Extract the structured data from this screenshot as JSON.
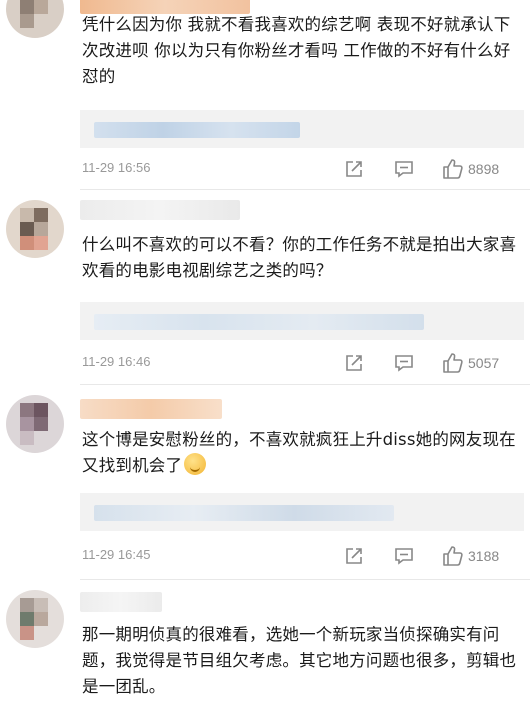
{
  "comments": [
    {
      "text": "凭什么因为你 我就不看我喜欢的综艺啊 表现不好就承认下次改进呗 你以为只有你粉丝才看吗 工作做的不好有什么好怼的",
      "time": "11-29 16:56",
      "likes": "8898",
      "share_icon": "share-icon",
      "comment_icon": "comment-icon",
      "like_icon": "thumbs-up-icon"
    },
    {
      "text": "什么叫不喜欢的可以不看？你的工作任务不就是拍出大家喜欢看的电影电视剧综艺之类的吗？",
      "time": "11-29 16:46",
      "likes": "5057",
      "share_icon": "share-icon",
      "comment_icon": "comment-icon",
      "like_icon": "thumbs-up-icon"
    },
    {
      "text": "这个博是安慰粉丝的，不喜欢就疯狂上升diss她的网友现在又找到机会了",
      "emoji": "shushing-face-emoji",
      "time": "11-29 16:45",
      "likes": "3188",
      "share_icon": "share-icon",
      "comment_icon": "comment-icon",
      "like_icon": "thumbs-up-icon"
    },
    {
      "text": "那一期明侦真的很难看，选她一个新玩家当侦探确实有问题，我觉得是节目组欠考虑。其它地方问题也很多，剪辑也是一团乱。"
    }
  ],
  "colors": {
    "text": "#1a1a1a",
    "meta": "#999999",
    "reply_bg": "#f2f2f2",
    "blur_blue": "#c9d8ea"
  }
}
